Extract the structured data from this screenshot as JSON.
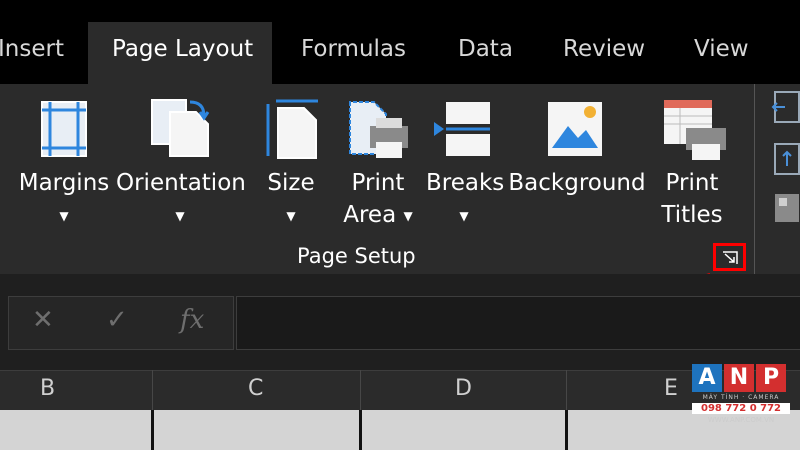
{
  "tabs": [
    "Insert",
    "Page Layout",
    "Formulas",
    "Data",
    "Review",
    "View"
  ],
  "active_tab": "Page Layout",
  "ribbon": {
    "margins": "Margins",
    "orientation": "Orientation",
    "size": "Size",
    "print_area_1": "Print",
    "print_area_2": "Area",
    "breaks": "Breaks",
    "background": "Background",
    "print_titles_1": "Print",
    "print_titles_2": "Titles",
    "caret": "▼",
    "group_label": "Page Setup"
  },
  "formula_bar": {
    "cancel": "✕",
    "enter": "✓",
    "fx": "fx"
  },
  "columns": [
    "B",
    "C",
    "D",
    "E"
  ],
  "logo": {
    "letters": [
      "A",
      "N",
      "P"
    ],
    "tagline": "MÁY TÍNH · CAMERA",
    "phone": "098 772 0 772",
    "web": "WWW.ANP.COM.VN"
  },
  "colors": {
    "accent_blue": "#2e86de",
    "highlight_red": "#ff0000",
    "logo_blue": "#1e73be",
    "logo_red": "#d32f2f"
  }
}
